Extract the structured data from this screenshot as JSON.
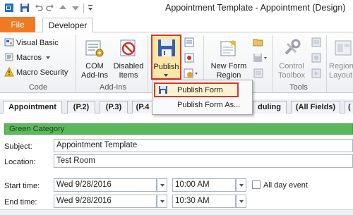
{
  "window": {
    "title": "Appointment Template  -  Appointment  (Design)"
  },
  "quick_access": {
    "icons": [
      "outlook-icon",
      "save-icon",
      "undo-icon",
      "redo-icon",
      "up-arrow-icon",
      "down-arrow-icon",
      "customize-qat-icon"
    ]
  },
  "ribbon": {
    "tabs": {
      "file": "File",
      "developer": "Developer"
    },
    "groups": {
      "code": {
        "label": "Code",
        "visual_basic": "Visual Basic",
        "macros": "Macros",
        "macro_security": "Macro Security"
      },
      "addins": {
        "label": "Add-Ins",
        "com_addins_line1": "COM",
        "com_addins_line2": "Add-Ins",
        "disabled_items_line1": "Disabled",
        "disabled_items_line2": "Items"
      },
      "publish": {
        "label": "Publish"
      },
      "new_form_region": {
        "line1": "New Form",
        "line2": "Region"
      },
      "tools": {
        "label": "Tools",
        "control_toolbox_line1": "Control",
        "control_toolbox_line2": "Toolbox"
      },
      "region_layout": {
        "line1": "Region",
        "line2": "Layout"
      }
    }
  },
  "publish_menu": {
    "items": [
      "Publish Form",
      "Publish Form As..."
    ]
  },
  "form_tabs": [
    "Appointment",
    "(P.2)",
    "(P.3)",
    "(P.4",
    "duling",
    "(All Fields)",
    "("
  ],
  "form": {
    "category": "Green Category",
    "subject_label": "Subject:",
    "subject_value": "Appointment Template",
    "location_label": "Location:",
    "location_value": "Test Room",
    "start_label": "Start time:",
    "start_date": "Wed 9/28/2016",
    "start_time": "10:00 AM",
    "all_day_label": "All day event",
    "end_label": "End time:",
    "end_date": "Wed 9/28/2016",
    "end_time": "10:30 AM"
  },
  "colors": {
    "file_tab": "#f07a22",
    "highlight_border": "#d6362f",
    "category": "#5cb85c"
  }
}
